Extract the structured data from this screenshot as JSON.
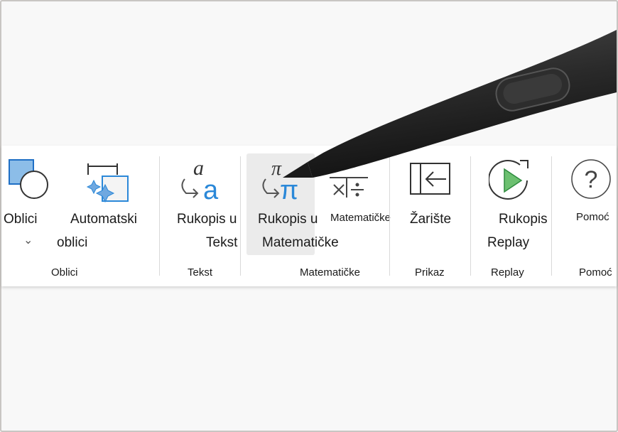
{
  "ribbon": {
    "groups": [
      {
        "label": "Oblici",
        "buttons": [
          {
            "label1": "Oblici",
            "icon": "shapes-icon",
            "has_dropdown": true
          },
          {
            "label1": "Automatski",
            "label2": "oblici",
            "icon": "auto-shapes-icon"
          }
        ]
      },
      {
        "label": "Tekst",
        "buttons": [
          {
            "label1": "Rukopis u",
            "label2": "Tekst",
            "icon": "ink-to-text-icon"
          }
        ]
      },
      {
        "label": "Matematičke",
        "buttons": [
          {
            "label1": "Rukopis u",
            "label2": "Matematičke",
            "icon": "ink-to-math-icon",
            "selected": true
          },
          {
            "label1": "Matematičke",
            "icon": "math-icon"
          }
        ]
      },
      {
        "label": "Prikaz",
        "buttons": [
          {
            "label1": "Žarište",
            "icon": "focus-icon"
          }
        ]
      },
      {
        "label": "Replay",
        "buttons": [
          {
            "label1": "Rukopis",
            "label2": "Replay",
            "icon": "ink-replay-icon"
          }
        ]
      },
      {
        "label": "Pomoć",
        "buttons": [
          {
            "label1": "Pomoć",
            "icon": "help-icon"
          }
        ]
      }
    ]
  },
  "colors": {
    "accent": "#2b88d8",
    "shape_fill": "#8cbde8",
    "replay_green": "#4caf50"
  }
}
